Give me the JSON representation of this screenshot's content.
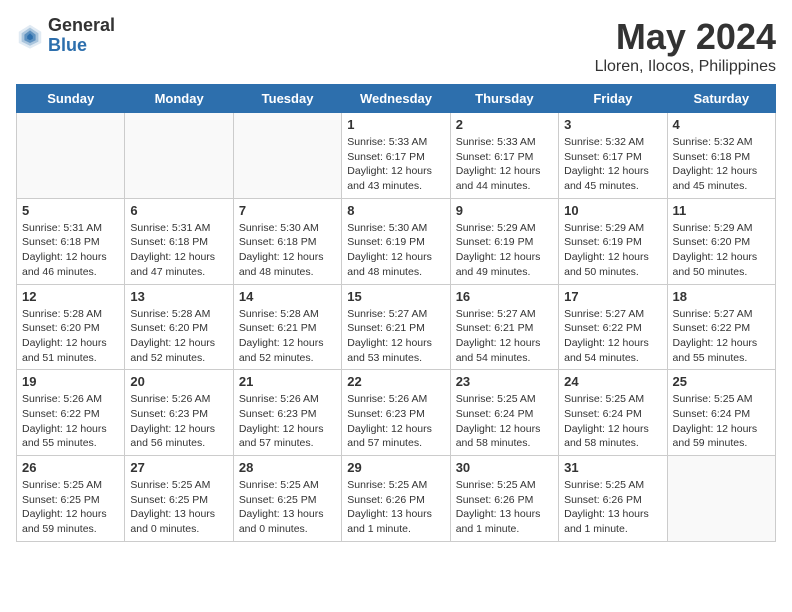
{
  "logo": {
    "general": "General",
    "blue": "Blue"
  },
  "title": "May 2024",
  "subtitle": "Lloren, Ilocos, Philippines",
  "headers": [
    "Sunday",
    "Monday",
    "Tuesday",
    "Wednesday",
    "Thursday",
    "Friday",
    "Saturday"
  ],
  "weeks": [
    [
      {
        "day": "",
        "sunrise": "",
        "sunset": "",
        "daylight": "",
        "empty": true
      },
      {
        "day": "",
        "sunrise": "",
        "sunset": "",
        "daylight": "",
        "empty": true
      },
      {
        "day": "",
        "sunrise": "",
        "sunset": "",
        "daylight": "",
        "empty": true
      },
      {
        "day": "1",
        "sunrise": "Sunrise: 5:33 AM",
        "sunset": "Sunset: 6:17 PM",
        "daylight": "Daylight: 12 hours and 43 minutes.",
        "empty": false
      },
      {
        "day": "2",
        "sunrise": "Sunrise: 5:33 AM",
        "sunset": "Sunset: 6:17 PM",
        "daylight": "Daylight: 12 hours and 44 minutes.",
        "empty": false
      },
      {
        "day": "3",
        "sunrise": "Sunrise: 5:32 AM",
        "sunset": "Sunset: 6:17 PM",
        "daylight": "Daylight: 12 hours and 45 minutes.",
        "empty": false
      },
      {
        "day": "4",
        "sunrise": "Sunrise: 5:32 AM",
        "sunset": "Sunset: 6:18 PM",
        "daylight": "Daylight: 12 hours and 45 minutes.",
        "empty": false
      }
    ],
    [
      {
        "day": "5",
        "sunrise": "Sunrise: 5:31 AM",
        "sunset": "Sunset: 6:18 PM",
        "daylight": "Daylight: 12 hours and 46 minutes.",
        "empty": false
      },
      {
        "day": "6",
        "sunrise": "Sunrise: 5:31 AM",
        "sunset": "Sunset: 6:18 PM",
        "daylight": "Daylight: 12 hours and 47 minutes.",
        "empty": false
      },
      {
        "day": "7",
        "sunrise": "Sunrise: 5:30 AM",
        "sunset": "Sunset: 6:18 PM",
        "daylight": "Daylight: 12 hours and 48 minutes.",
        "empty": false
      },
      {
        "day": "8",
        "sunrise": "Sunrise: 5:30 AM",
        "sunset": "Sunset: 6:19 PM",
        "daylight": "Daylight: 12 hours and 48 minutes.",
        "empty": false
      },
      {
        "day": "9",
        "sunrise": "Sunrise: 5:29 AM",
        "sunset": "Sunset: 6:19 PM",
        "daylight": "Daylight: 12 hours and 49 minutes.",
        "empty": false
      },
      {
        "day": "10",
        "sunrise": "Sunrise: 5:29 AM",
        "sunset": "Sunset: 6:19 PM",
        "daylight": "Daylight: 12 hours and 50 minutes.",
        "empty": false
      },
      {
        "day": "11",
        "sunrise": "Sunrise: 5:29 AM",
        "sunset": "Sunset: 6:20 PM",
        "daylight": "Daylight: 12 hours and 50 minutes.",
        "empty": false
      }
    ],
    [
      {
        "day": "12",
        "sunrise": "Sunrise: 5:28 AM",
        "sunset": "Sunset: 6:20 PM",
        "daylight": "Daylight: 12 hours and 51 minutes.",
        "empty": false
      },
      {
        "day": "13",
        "sunrise": "Sunrise: 5:28 AM",
        "sunset": "Sunset: 6:20 PM",
        "daylight": "Daylight: 12 hours and 52 minutes.",
        "empty": false
      },
      {
        "day": "14",
        "sunrise": "Sunrise: 5:28 AM",
        "sunset": "Sunset: 6:21 PM",
        "daylight": "Daylight: 12 hours and 52 minutes.",
        "empty": false
      },
      {
        "day": "15",
        "sunrise": "Sunrise: 5:27 AM",
        "sunset": "Sunset: 6:21 PM",
        "daylight": "Daylight: 12 hours and 53 minutes.",
        "empty": false
      },
      {
        "day": "16",
        "sunrise": "Sunrise: 5:27 AM",
        "sunset": "Sunset: 6:21 PM",
        "daylight": "Daylight: 12 hours and 54 minutes.",
        "empty": false
      },
      {
        "day": "17",
        "sunrise": "Sunrise: 5:27 AM",
        "sunset": "Sunset: 6:22 PM",
        "daylight": "Daylight: 12 hours and 54 minutes.",
        "empty": false
      },
      {
        "day": "18",
        "sunrise": "Sunrise: 5:27 AM",
        "sunset": "Sunset: 6:22 PM",
        "daylight": "Daylight: 12 hours and 55 minutes.",
        "empty": false
      }
    ],
    [
      {
        "day": "19",
        "sunrise": "Sunrise: 5:26 AM",
        "sunset": "Sunset: 6:22 PM",
        "daylight": "Daylight: 12 hours and 55 minutes.",
        "empty": false
      },
      {
        "day": "20",
        "sunrise": "Sunrise: 5:26 AM",
        "sunset": "Sunset: 6:23 PM",
        "daylight": "Daylight: 12 hours and 56 minutes.",
        "empty": false
      },
      {
        "day": "21",
        "sunrise": "Sunrise: 5:26 AM",
        "sunset": "Sunset: 6:23 PM",
        "daylight": "Daylight: 12 hours and 57 minutes.",
        "empty": false
      },
      {
        "day": "22",
        "sunrise": "Sunrise: 5:26 AM",
        "sunset": "Sunset: 6:23 PM",
        "daylight": "Daylight: 12 hours and 57 minutes.",
        "empty": false
      },
      {
        "day": "23",
        "sunrise": "Sunrise: 5:25 AM",
        "sunset": "Sunset: 6:24 PM",
        "daylight": "Daylight: 12 hours and 58 minutes.",
        "empty": false
      },
      {
        "day": "24",
        "sunrise": "Sunrise: 5:25 AM",
        "sunset": "Sunset: 6:24 PM",
        "daylight": "Daylight: 12 hours and 58 minutes.",
        "empty": false
      },
      {
        "day": "25",
        "sunrise": "Sunrise: 5:25 AM",
        "sunset": "Sunset: 6:24 PM",
        "daylight": "Daylight: 12 hours and 59 minutes.",
        "empty": false
      }
    ],
    [
      {
        "day": "26",
        "sunrise": "Sunrise: 5:25 AM",
        "sunset": "Sunset: 6:25 PM",
        "daylight": "Daylight: 12 hours and 59 minutes.",
        "empty": false
      },
      {
        "day": "27",
        "sunrise": "Sunrise: 5:25 AM",
        "sunset": "Sunset: 6:25 PM",
        "daylight": "Daylight: 13 hours and 0 minutes.",
        "empty": false
      },
      {
        "day": "28",
        "sunrise": "Sunrise: 5:25 AM",
        "sunset": "Sunset: 6:25 PM",
        "daylight": "Daylight: 13 hours and 0 minutes.",
        "empty": false
      },
      {
        "day": "29",
        "sunrise": "Sunrise: 5:25 AM",
        "sunset": "Sunset: 6:26 PM",
        "daylight": "Daylight: 13 hours and 1 minute.",
        "empty": false
      },
      {
        "day": "30",
        "sunrise": "Sunrise: 5:25 AM",
        "sunset": "Sunset: 6:26 PM",
        "daylight": "Daylight: 13 hours and 1 minute.",
        "empty": false
      },
      {
        "day": "31",
        "sunrise": "Sunrise: 5:25 AM",
        "sunset": "Sunset: 6:26 PM",
        "daylight": "Daylight: 13 hours and 1 minute.",
        "empty": false
      },
      {
        "day": "",
        "sunrise": "",
        "sunset": "",
        "daylight": "",
        "empty": true
      }
    ]
  ]
}
